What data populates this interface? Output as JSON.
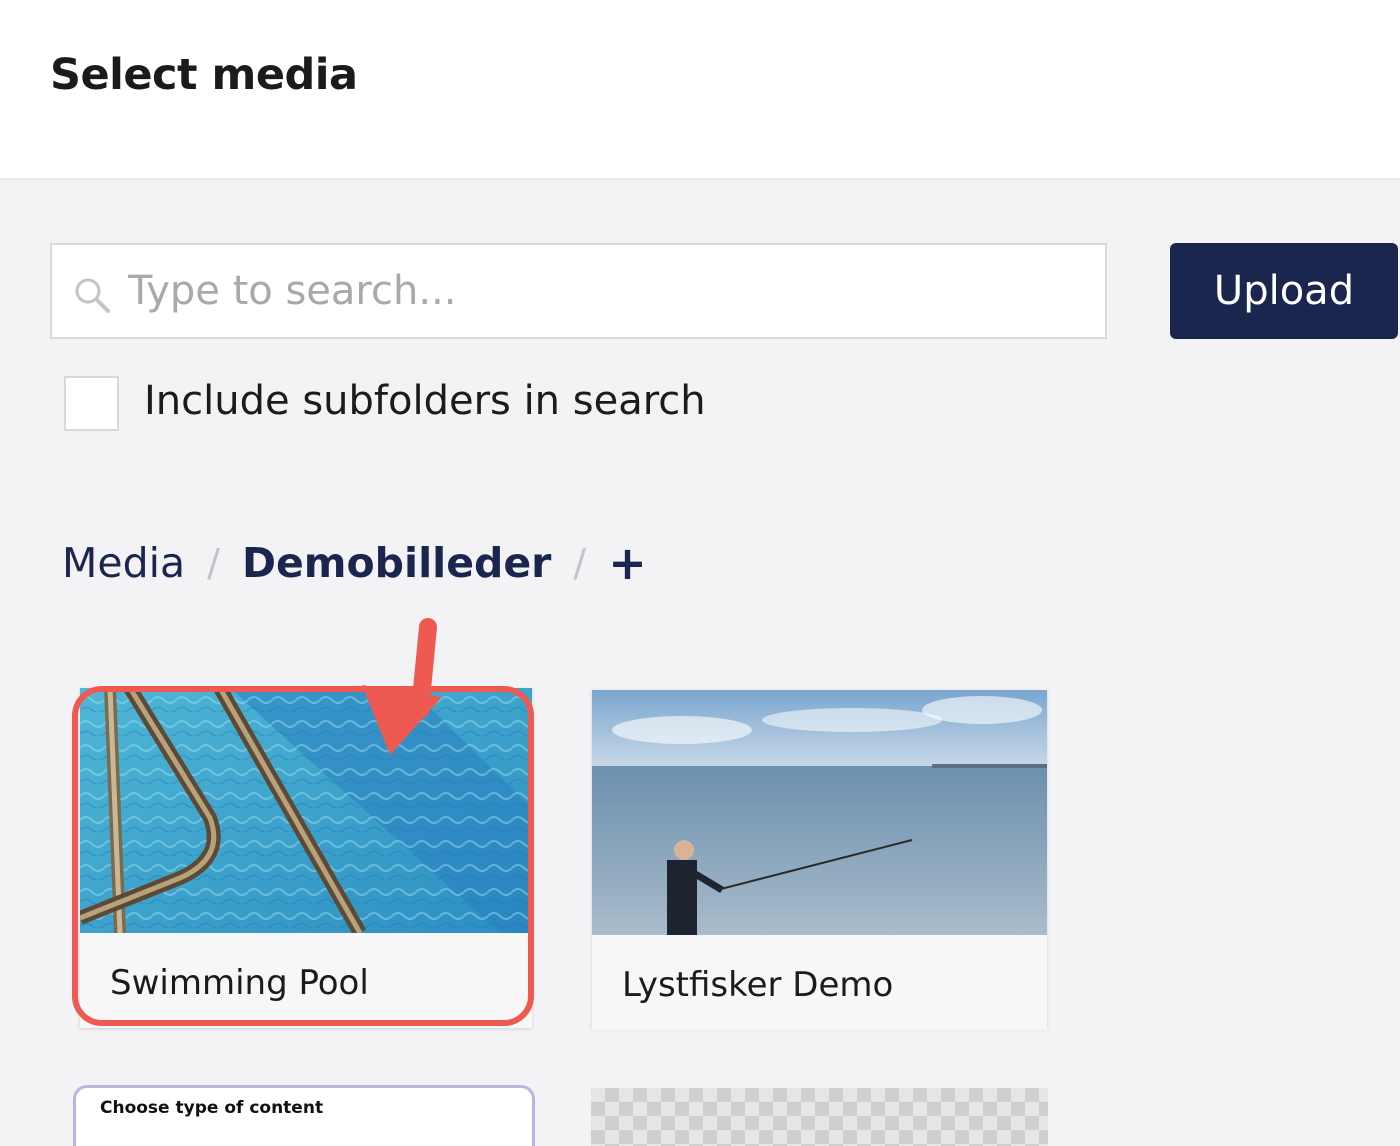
{
  "header": {
    "title": "Select media"
  },
  "search": {
    "placeholder": "Type to search...",
    "value": ""
  },
  "toolbar": {
    "upload_label": "Upload"
  },
  "options": {
    "include_subfolders_label": "Include subfolders in search",
    "include_subfolders_checked": false
  },
  "breadcrumb": {
    "root": "Media",
    "separator": "/",
    "current": "Demobilleder",
    "add": "+"
  },
  "media_items": [
    {
      "name": "Swimming Pool",
      "icon": "pool-photo"
    },
    {
      "name": "Lystfisker Demo",
      "icon": "fisherman-photo"
    }
  ],
  "partial_items": {
    "choose_content_label": "Choose type of content"
  },
  "colors": {
    "primary": "#1b264f",
    "highlight": "#ee5a52",
    "background": "#f3f2f4"
  }
}
